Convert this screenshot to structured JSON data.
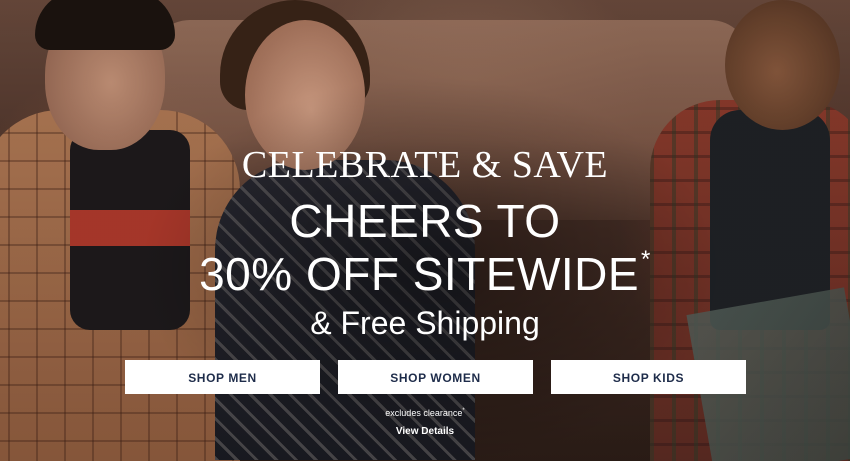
{
  "hero": {
    "eyebrow": "CELEBRATE & SAVE",
    "headline_line1": "CHEERS TO",
    "headline_line2": "30% OFF SITEWIDE",
    "headline_asterisk": "*",
    "subline": "& Free Shipping",
    "buttons": [
      {
        "label": "SHOP MEN"
      },
      {
        "label": "SHOP WOMEN"
      },
      {
        "label": "SHOP KIDS"
      }
    ],
    "note": "excludes clearance",
    "note_mark": "*",
    "details_link": "View Details"
  },
  "colors": {
    "button_bg": "#ffffff",
    "button_text": "#1e2c4a",
    "overlay_text": "#ffffff"
  }
}
